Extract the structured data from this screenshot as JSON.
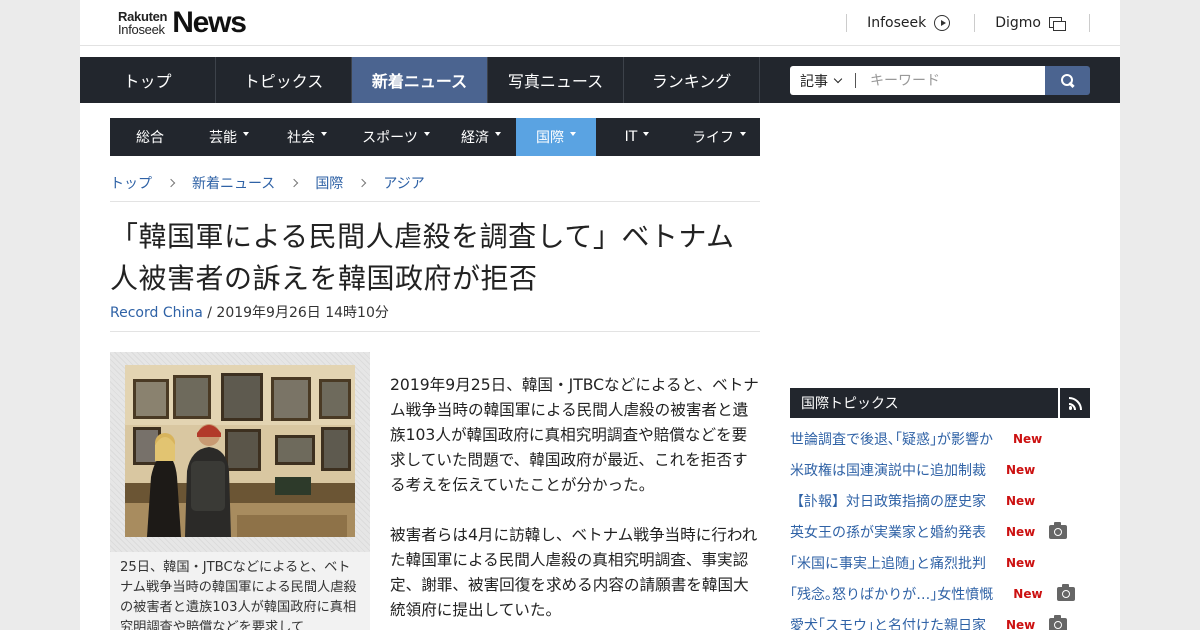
{
  "header": {
    "logo_small_top": "Rakuten",
    "logo_small_bottom": "Infoseek",
    "logo_big": "News",
    "links": [
      {
        "label": "Infoseek",
        "icon": "circle-arrow-icon"
      },
      {
        "label": "Digmo",
        "icon": "windows-icon"
      }
    ]
  },
  "main_nav": {
    "items": [
      "トップ",
      "トピックス",
      "新着ニュース",
      "写真ニュース",
      "ランキング"
    ],
    "active": "新着ニュース"
  },
  "search": {
    "category": "記事",
    "placeholder": "キーワード"
  },
  "sub_nav": {
    "items": [
      {
        "label": "総合",
        "dropdown": false
      },
      {
        "label": "芸能",
        "dropdown": true
      },
      {
        "label": "社会",
        "dropdown": true
      },
      {
        "label": "スポーツ",
        "dropdown": true
      },
      {
        "label": "経済",
        "dropdown": true
      },
      {
        "label": "国際",
        "dropdown": true
      },
      {
        "label": "IT",
        "dropdown": true
      },
      {
        "label": "ライフ",
        "dropdown": true
      }
    ],
    "active": "国際"
  },
  "breadcrumb": [
    "トップ",
    "新着ニュース",
    "国際",
    "アジア"
  ],
  "article": {
    "title_line1": "「韓国軍による民間人虐殺を調査して」ベトナム",
    "title_line2": "人被害者の訴えを韓国政府が拒否",
    "source": "Record China",
    "date": " / 2019年9月26日 14時10分",
    "caption": "25日、韓国・JTBCなどによると、ベトナム戦争当時の韓国軍による民間人虐殺の被害者と遺族103人が韓国政府に真相究明調査や賠償などを要求して",
    "paragraphs": [
      "2019年9月25日、韓国・JTBCなどによると、ベトナム戦争当時の韓国軍による民間人虐殺の被害者と遺族103人が韓国政府に真相究明調査や賠償などを要求していた問題で、韓国政府が最近、これを拒否する考えを伝えていたことが分かった。",
      "被害者らは4月に訪韓し、ベトナム戦争当時に行われた韓国軍による民間人虐殺の真相究明調査、事実認定、謝罪、被害回復を求める内容の請願書を韓国大統領府に提出していた。"
    ]
  },
  "sidebar": {
    "title": "国際トピックス",
    "topics": [
      {
        "text": "世論調査で後退､｢疑惑｣が影響か",
        "badge": "New",
        "photo": false
      },
      {
        "text": "米政権は国連演説中に追加制裁",
        "badge": "New",
        "photo": false
      },
      {
        "text": "【訃報】対日政策指摘の歴史家",
        "badge": "New",
        "photo": false
      },
      {
        "text": "英女王の孫が実業家と婚約発表",
        "badge": "New",
        "photo": true
      },
      {
        "text": "｢米国に事実上追随｣と痛烈批判",
        "badge": "New",
        "photo": false
      },
      {
        "text": "｢残念｡怒りばかりが…｣女性憤慨",
        "badge": "New",
        "photo": true
      },
      {
        "text": "愛犬｢スモウ｣と名付けた親日家",
        "badge": "New",
        "photo": true
      }
    ]
  },
  "colors": {
    "nav_bg": "#22262d",
    "nav_active": "#4b6490",
    "subnav_active": "#5aa3e2",
    "link": "#2f62a6",
    "new_badge": "#cc1111"
  }
}
